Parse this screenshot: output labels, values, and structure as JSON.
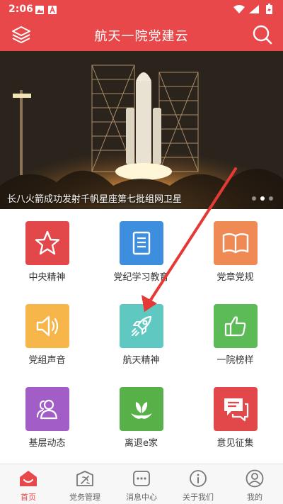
{
  "status": {
    "time": "2:06"
  },
  "header": {
    "title": "航天一院党建云"
  },
  "banner": {
    "caption": "长八火箭成功发射千帆星座第七批组网卫星",
    "slide_count": 3,
    "active_slide": 2
  },
  "grid": [
    {
      "label": "中央精神",
      "icon": "star-icon",
      "color": "#e2474a"
    },
    {
      "label": "党纪学习教育",
      "icon": "document-list-icon",
      "color": "#3e8ee0"
    },
    {
      "label": "党章党规",
      "icon": "open-book-icon",
      "color": "#f08a54"
    },
    {
      "label": "党组声音",
      "icon": "speaker-icon",
      "color": "#f6b64a"
    },
    {
      "label": "航天精神",
      "icon": "rocket-icon",
      "color": "#5fc9c1"
    },
    {
      "label": "一院榜样",
      "icon": "thumbs-up-icon",
      "color": "#5cbb56"
    },
    {
      "label": "基层动态",
      "icon": "people-icon",
      "color": "#a35dc7"
    },
    {
      "label": "离退e家",
      "icon": "leaf-hands-icon",
      "color": "#58b049"
    },
    {
      "label": "意见征集",
      "icon": "chat-bubbles-icon",
      "color": "#e2474a"
    }
  ],
  "tabs": [
    {
      "label": "首页",
      "icon": "home-icon",
      "active": true
    },
    {
      "label": "党务管理",
      "icon": "party-emblem-icon",
      "active": false
    },
    {
      "label": "消息中心",
      "icon": "message-icon",
      "active": false
    },
    {
      "label": "关于我们",
      "icon": "info-icon",
      "active": false
    },
    {
      "label": "我的",
      "icon": "user-icon",
      "active": false
    }
  ],
  "colors": {
    "brand": "#e8484a",
    "annotation_arrow": "#e53935"
  }
}
